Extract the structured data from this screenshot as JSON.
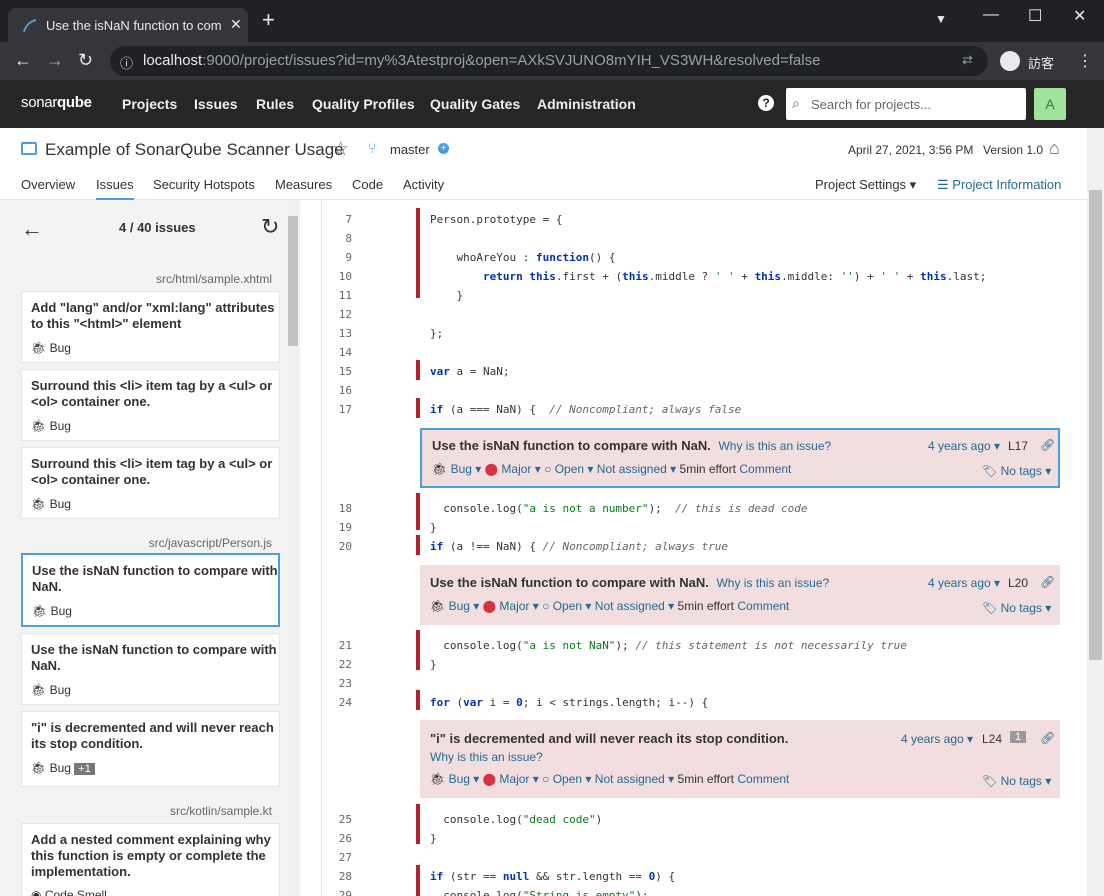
{
  "browser": {
    "tab_title": "Use the isNaN function to compare with NaN.",
    "url_host": "localhost",
    "url_rest": ":9000/project/issues?id=my%3Atestproj&open=AXkSVJUNO8mYIH_VS3WH&resolved=false",
    "profile": "訪客"
  },
  "nav": {
    "logo_a": "sonar",
    "logo_b": "qube",
    "items": [
      "Projects",
      "Issues",
      "Rules",
      "Quality Profiles",
      "Quality Gates",
      "Administration"
    ],
    "search_placeholder": "Search for projects...",
    "avatar": "A"
  },
  "project": {
    "name": "Example of SonarQube Scanner Usage",
    "branch": "master",
    "date": "April 27, 2021, 3:56 PM",
    "version": "Version 1.0",
    "tabs": [
      "Overview",
      "Issues",
      "Security Hotspots",
      "Measures",
      "Code",
      "Activity"
    ],
    "settings": "Project Settings",
    "info": "Project Information"
  },
  "sidebar": {
    "count": "4 / 40 issues",
    "c1": "src/html/sample.xhtml",
    "i1": "Add \"lang\" and/or \"xml:lang\" attributes to this \"<html>\" element",
    "i2": "Surround this <li> item tag by a <ul> or <ol> container one.",
    "i3": "Surround this <li> item tag by a <ul> or <ol> container one.",
    "c2": "src/javascript/Person.js",
    "i4": "Use the isNaN function to compare with NaN.",
    "i5": "Use the isNaN function to compare with NaN.",
    "i6": "\"i\" is decremented and will never reach its stop condition.",
    "i6_extra": "+1",
    "c3": "src/kotlin/sample.kt",
    "i7": "Add a nested comment explaining why this function is empty or complete the implementation.",
    "bug": "Bug",
    "smell": "Code Smell"
  },
  "code": {
    "lines": [
      "7",
      "8",
      "9",
      "10",
      "11",
      "12",
      "13",
      "14",
      "15",
      "16",
      "17",
      "18",
      "19",
      "20",
      "21",
      "22",
      "23",
      "24",
      "25",
      "26",
      "27",
      "28",
      "29"
    ]
  },
  "issues": {
    "t1": "Use the isNaN function to compare with NaN.",
    "t2": "Use the isNaN function to compare with NaN.",
    "t3": "\"i\" is decremented and will never reach its stop condition.",
    "why": "Why is this an issue?",
    "ago": "4 years ago",
    "l1": "L17",
    "l2": "L20",
    "l3": "L24",
    "cnt3": "1",
    "type": "Bug",
    "sev": "Major",
    "status": "Open",
    "assign": "Not assigned",
    "effort": "5min effort",
    "comment": "Comment",
    "tags": "No tags"
  },
  "colors": {
    "accent": "#4b9fd5",
    "issue_bg": "#f2dede",
    "bar": "#b7202d",
    "nav_bg": "#262626"
  }
}
